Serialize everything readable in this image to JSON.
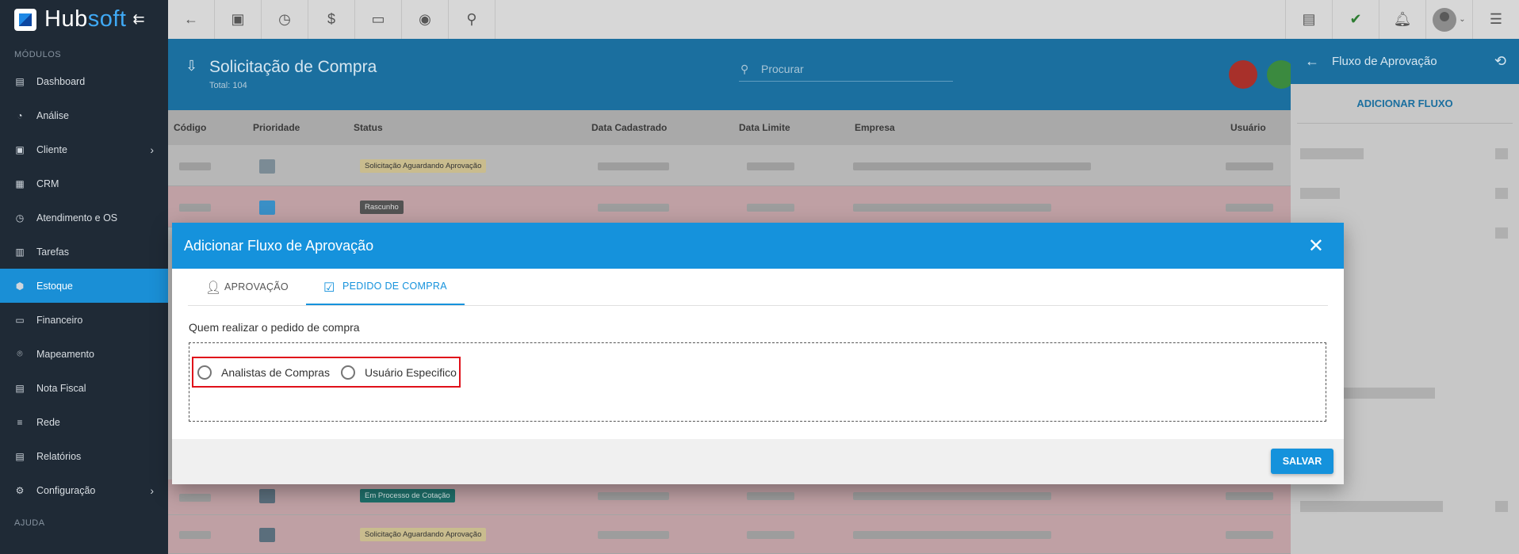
{
  "app": {
    "logo_text_a": "Hub",
    "logo_text_b": "soft"
  },
  "sidebar": {
    "section_modules": "MÓDULOS",
    "section_help": "AJUDA",
    "items": [
      {
        "label": "Dashboard",
        "icon": "dashboard-icon"
      },
      {
        "label": "Análise",
        "icon": "pie-chart-icon"
      },
      {
        "label": "Cliente",
        "icon": "contact-icon",
        "has_children": true
      },
      {
        "label": "CRM",
        "icon": "crm-icon"
      },
      {
        "label": "Atendimento e OS",
        "icon": "calendar-clock-icon"
      },
      {
        "label": "Tarefas",
        "icon": "tasks-icon"
      },
      {
        "label": "Estoque",
        "icon": "box-icon",
        "active": true
      },
      {
        "label": "Financeiro",
        "icon": "money-icon"
      },
      {
        "label": "Mapeamento",
        "icon": "map-pin-icon"
      },
      {
        "label": "Nota Fiscal",
        "icon": "invoice-icon"
      },
      {
        "label": "Rede",
        "icon": "network-icon"
      },
      {
        "label": "Relatórios",
        "icon": "report-icon"
      },
      {
        "label": "Configuração",
        "icon": "gear-icon",
        "has_children": true
      }
    ]
  },
  "page": {
    "title": "Solicitação de Compra",
    "total": "Total: 104",
    "search_placeholder": "Procurar",
    "columns": [
      "Código",
      "Prioridade",
      "Status",
      "Data Cadastrado",
      "Data Limite",
      "Empresa",
      "Usuário"
    ],
    "rows": [
      {
        "status": "Solicitação Aguardando Aprovação",
        "style": "yellow"
      },
      {
        "status": "Rascunho",
        "style": "dark"
      },
      {
        "status": "Em Processo de Cotação",
        "style": "teal"
      },
      {
        "status": "Solicitação Aguardando Aprovação",
        "style": "yellow"
      }
    ]
  },
  "right_panel": {
    "title": "Fluxo de Aprovação",
    "add_flow": "ADICIONAR FLUXO"
  },
  "modal": {
    "title": "Adicionar Fluxo de Aprovação",
    "tabs": [
      {
        "label": "APROVAÇÃO",
        "icon": "user-check-icon",
        "active": false
      },
      {
        "label": "PEDIDO DE COMPRA",
        "icon": "clipboard-check-icon",
        "active": true
      }
    ],
    "field_label": "Quem realizar o pedido de compra",
    "options": [
      {
        "label": "Analistas de Compras",
        "selected": false
      },
      {
        "label": "Usuário Especifico",
        "selected": false
      }
    ],
    "save_label": "SALVAR"
  },
  "colors": {
    "primary": "#1592dc",
    "sidebar": "#1f2a36",
    "highlight": "#e0101a"
  }
}
